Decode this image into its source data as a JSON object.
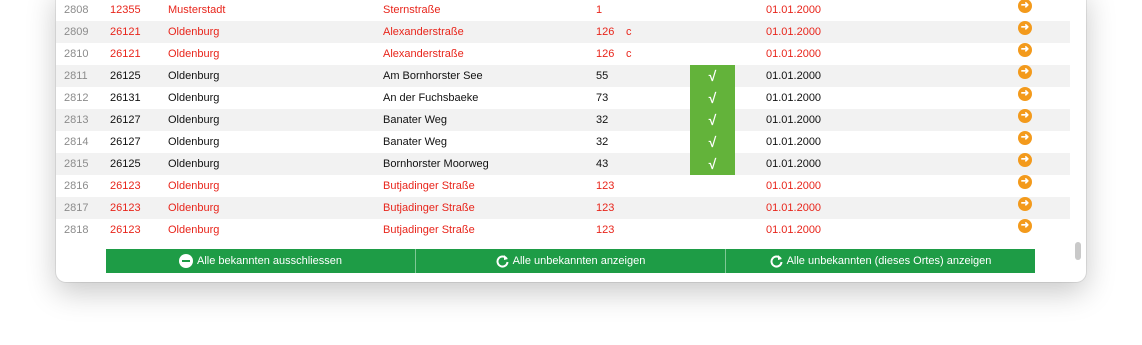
{
  "rows": [
    {
      "num": "2808",
      "plz": "12355",
      "ort": "Musterstadt",
      "strasse": "Sternstraße",
      "hnr": "1",
      "zusatz": "",
      "date": "01.01.2000",
      "known": false,
      "check": false
    },
    {
      "num": "2809",
      "plz": "26121",
      "ort": "Oldenburg",
      "strasse": "Alexanderstraße",
      "hnr": "126",
      "zusatz": "c",
      "date": "01.01.2000",
      "known": false,
      "check": false
    },
    {
      "num": "2810",
      "plz": "26121",
      "ort": "Oldenburg",
      "strasse": "Alexanderstraße",
      "hnr": "126",
      "zusatz": "c",
      "date": "01.01.2000",
      "known": false,
      "check": false
    },
    {
      "num": "2811",
      "plz": "26125",
      "ort": "Oldenburg",
      "strasse": "Am Bornhorster See",
      "hnr": "55",
      "zusatz": "",
      "date": "01.01.2000",
      "known": true,
      "check": true
    },
    {
      "num": "2812",
      "plz": "26131",
      "ort": "Oldenburg",
      "strasse": "An der Fuchsbaeke",
      "hnr": "73",
      "zusatz": "",
      "date": "01.01.2000",
      "known": true,
      "check": true
    },
    {
      "num": "2813",
      "plz": "26127",
      "ort": "Oldenburg",
      "strasse": "Banater Weg",
      "hnr": "32",
      "zusatz": "",
      "date": "01.01.2000",
      "known": true,
      "check": true
    },
    {
      "num": "2814",
      "plz": "26127",
      "ort": "Oldenburg",
      "strasse": "Banater Weg",
      "hnr": "32",
      "zusatz": "",
      "date": "01.01.2000",
      "known": true,
      "check": true
    },
    {
      "num": "2815",
      "plz": "26125",
      "ort": "Oldenburg",
      "strasse": "Bornhorster Moorweg",
      "hnr": "43",
      "zusatz": "",
      "date": "01.01.2000",
      "known": true,
      "check": true
    },
    {
      "num": "2816",
      "plz": "26123",
      "ort": "Oldenburg",
      "strasse": "Butjadinger Straße",
      "hnr": "123",
      "zusatz": "",
      "date": "01.01.2000",
      "known": false,
      "check": false
    },
    {
      "num": "2817",
      "plz": "26123",
      "ort": "Oldenburg",
      "strasse": "Butjadinger Straße",
      "hnr": "123",
      "zusatz": "",
      "date": "01.01.2000",
      "known": false,
      "check": false
    },
    {
      "num": "2818",
      "plz": "26123",
      "ort": "Oldenburg",
      "strasse": "Butjadinger Straße",
      "hnr": "123",
      "zusatz": "",
      "date": "01.01.2000",
      "known": false,
      "check": false
    }
  ],
  "check_glyph": "√",
  "arrow_icon": "arrow-right-circle-icon",
  "buttons": {
    "exclude_known": "Alle bekannten ausschliessen",
    "show_unknown": "Alle unbekannten anzeigen",
    "show_unknown_place": "Alle unbekannten (dieses Ortes) anzeigen"
  },
  "colors": {
    "unknown_text": "#e8251b",
    "check_bg": "#63b33a",
    "button_bg": "#1e9c46",
    "arrow": "#f39a1c"
  }
}
